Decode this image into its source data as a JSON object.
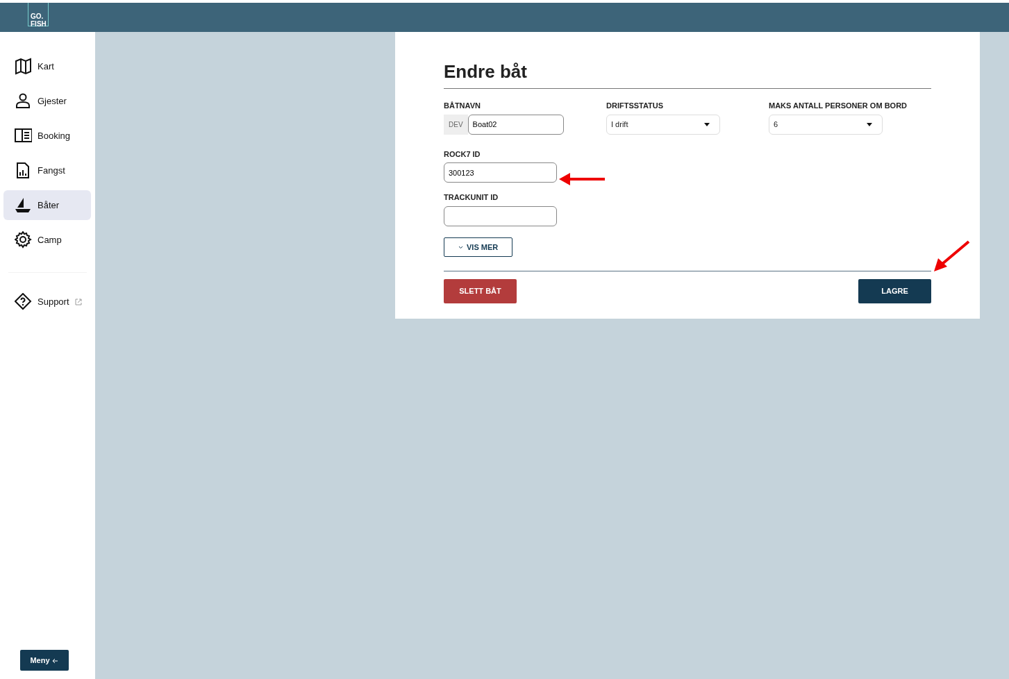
{
  "logo": {
    "line1": "GO.",
    "line2": "FISH"
  },
  "sidebar": {
    "items": [
      {
        "label": "Kart",
        "selected": false
      },
      {
        "label": "Gjester",
        "selected": false
      },
      {
        "label": "Booking",
        "selected": false
      },
      {
        "label": "Fangst",
        "selected": false
      },
      {
        "label": "Båter",
        "selected": true
      },
      {
        "label": "Camp",
        "selected": false
      }
    ],
    "support": {
      "label": "Support",
      "selected": false,
      "external": true
    },
    "menu_button": "Meny"
  },
  "form": {
    "title": "Endre båt",
    "fields": [
      {
        "kind": "prefixed",
        "label": "BÅTNAVN",
        "prefix": "DEV",
        "value": "Boat02"
      },
      {
        "kind": "select",
        "label": "DRIFTSSTATUS",
        "value": "I drift"
      },
      {
        "kind": "select",
        "label": "MAKS ANTALL PERSONER OM BORD",
        "value": "6"
      },
      {
        "kind": "text",
        "label": "ROCK7 ID",
        "value": "300123"
      },
      {
        "kind": "text",
        "label": "TRACKUNIT ID"
      }
    ],
    "more_button": "VIS MER",
    "delete_button": "SLETT BÅT",
    "save_button": "LAGRE"
  }
}
